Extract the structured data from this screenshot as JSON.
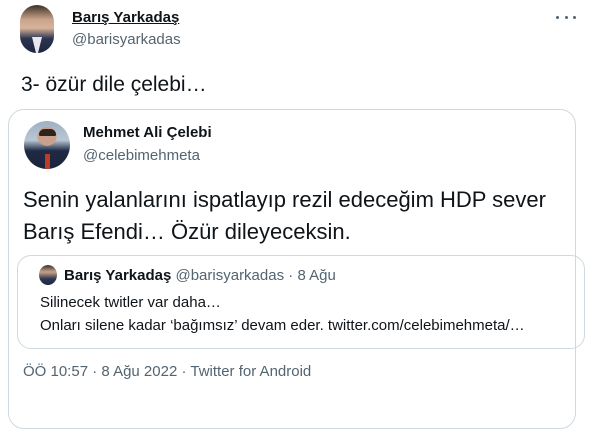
{
  "tweet": {
    "author_name": "Barış Yarkadaş",
    "author_handle": "@barisyarkadas",
    "text": "3- özür dile çelebi…"
  },
  "quoted_tweet": {
    "author_name": "Mehmet Ali Çelebi",
    "author_handle": "@celebimehmeta",
    "text": "Senin yalanlarını ispatlayıp rezil edeceğim HDP sever Barış Efendi… Özür dileyeceksin.",
    "inner_quote": {
      "author_name": "Barış Yarkadaş",
      "author_handle": "@barisyarkadas",
      "separator": " · ",
      "date": "8 Ağu",
      "line1": "Silinecek twitler var daha…",
      "line2": "Onları silene kadar ‘bağımsız’ devam eder. twitter.com/celebimehmeta/…"
    },
    "time": "ÖÖ 10:57",
    "meta_separator": " · ",
    "date": "8 Ağu 2022",
    "source": "Twitter for Android"
  },
  "icons": {
    "more": "more-icon"
  },
  "colors": {
    "text_primary": "#0f1419",
    "text_secondary": "#536471",
    "border": "#cfd9de"
  }
}
